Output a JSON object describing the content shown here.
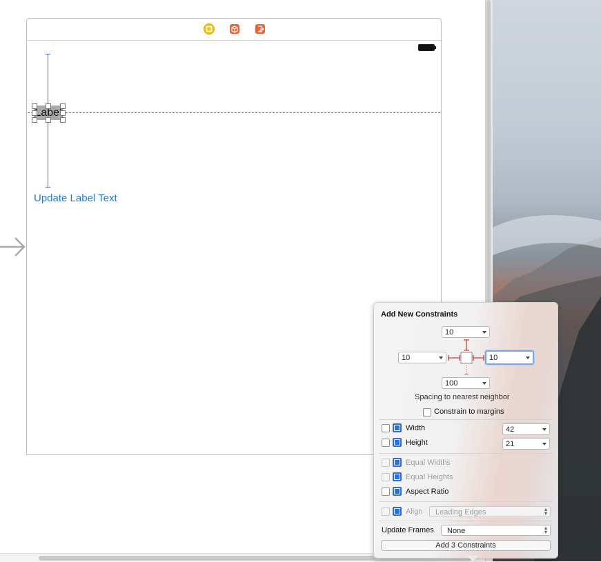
{
  "canvas": {
    "scene": {
      "dock_icons": [
        "view-controller-icon",
        "first-responder-icon",
        "exit-icon"
      ],
      "label": {
        "text": "Label"
      },
      "button": {
        "label": "Update Label Text"
      }
    }
  },
  "popover": {
    "title": "Add New Constraints",
    "spacing": {
      "top": "10",
      "left": "10",
      "right": "10",
      "bottom": "100"
    },
    "spacing_caption": "Spacing to nearest neighbor",
    "constrain_margins_label": "Constrain to margins",
    "width": {
      "label": "Width",
      "value": "42"
    },
    "height": {
      "label": "Height",
      "value": "21"
    },
    "equal_widths_label": "Equal Widths",
    "equal_heights_label": "Equal Heights",
    "aspect_ratio_label": "Aspect Ratio",
    "align": {
      "label": "Align",
      "value": "Leading Edges"
    },
    "update_frames": {
      "label": "Update Frames",
      "value": "None"
    },
    "add_button_label": "Add 3 Constraints"
  },
  "colors": {
    "accent": "#1e7ad6",
    "constraint_red": "#c8352b",
    "icon_blue": "#2f6fd1"
  }
}
